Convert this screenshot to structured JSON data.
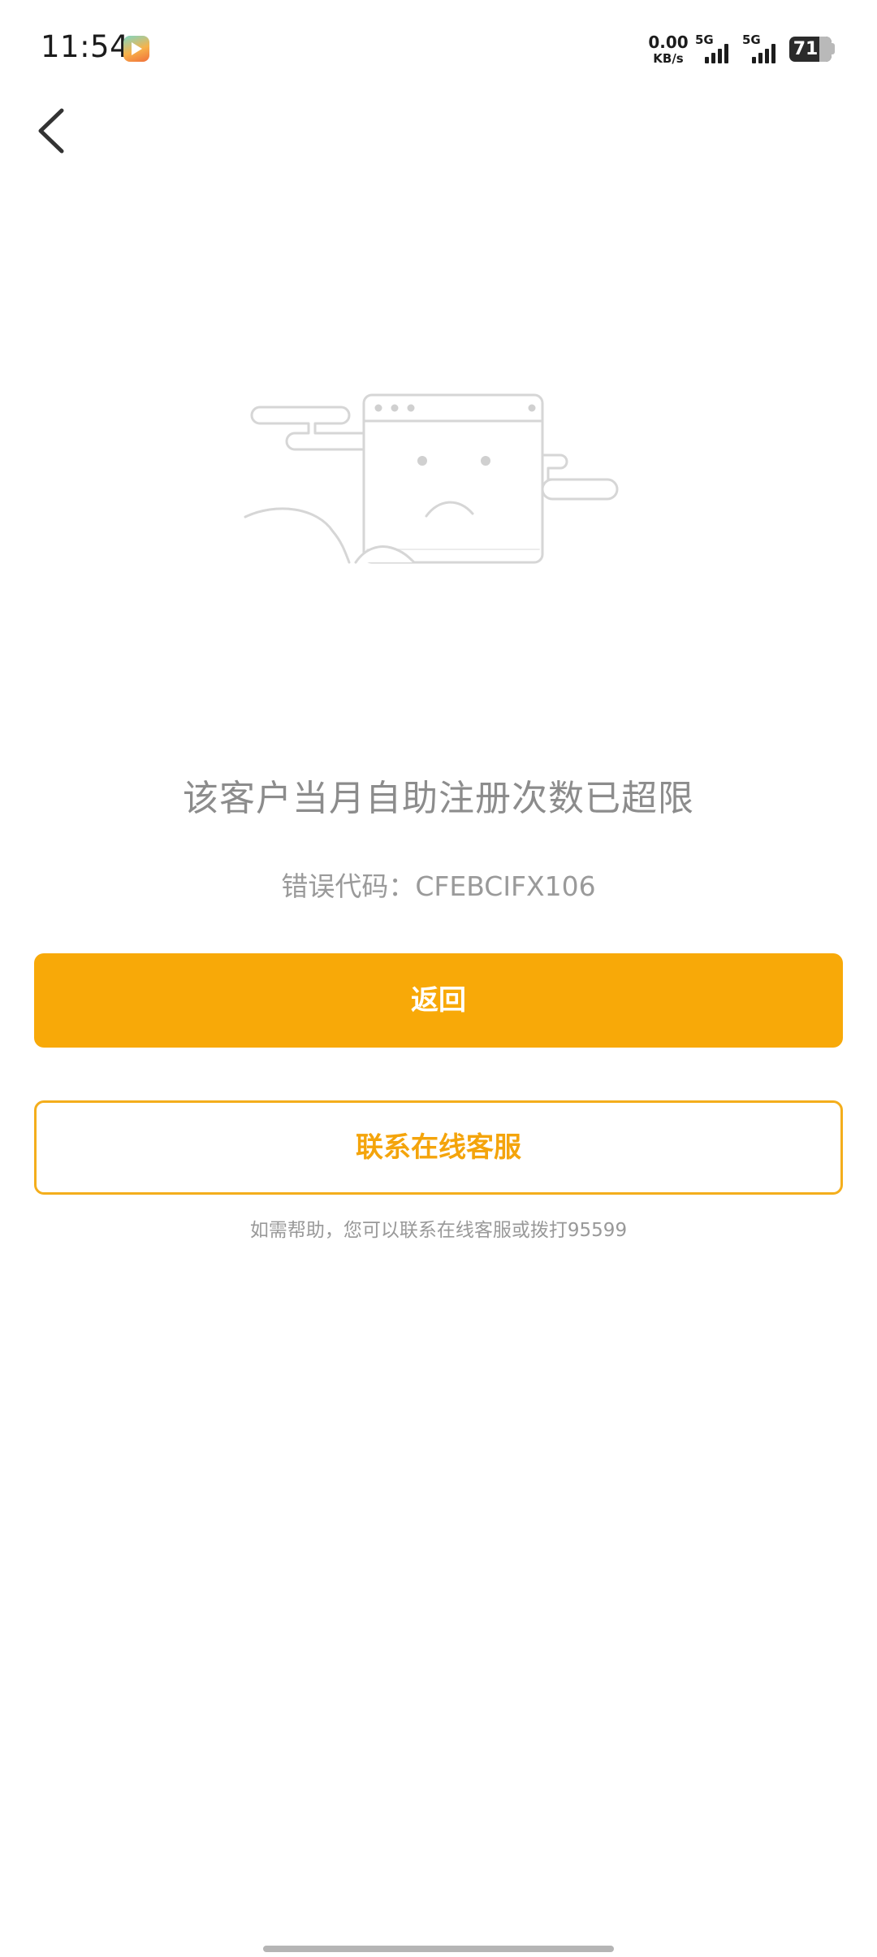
{
  "status_bar": {
    "time": "11:54",
    "net_speed_value": "0.00",
    "net_speed_unit": "KB/s",
    "sim1_label": "5G",
    "sim2_label": "5G",
    "battery_level": "71"
  },
  "nav": {
    "back_icon": "chevron-left-icon"
  },
  "illustration": {
    "icon": "sad-browser-window-icon"
  },
  "error": {
    "title": "该客户当月自助注册次数已超限",
    "code_text": "错误代码：CFEBCIFX106"
  },
  "actions": {
    "return_label": "返回",
    "contact_label": "联系在线客服"
  },
  "help": {
    "text": "如需帮助，您可以联系在线客服或拨打95599"
  },
  "colors": {
    "accent": "#f8a908",
    "muted_text": "#8c8c8c"
  }
}
